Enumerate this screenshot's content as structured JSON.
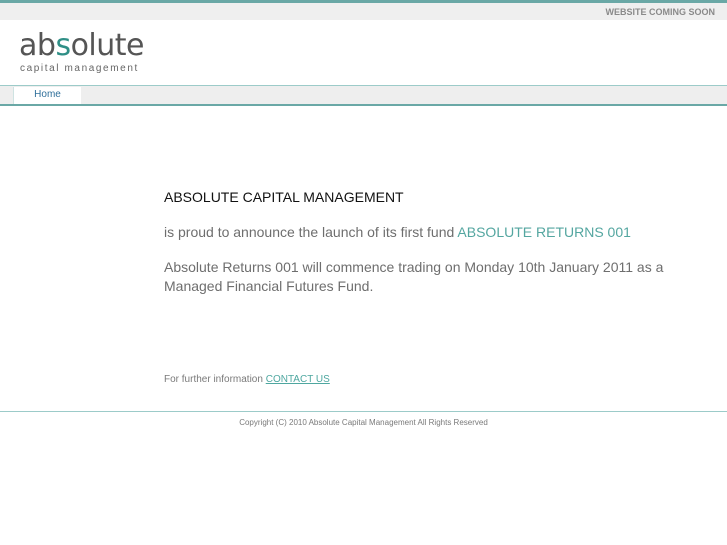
{
  "header": {
    "coming_soon": "WEBSITE COMING SOON"
  },
  "logo": {
    "word_start": "ab",
    "word_accent": "s",
    "word_end": "olute",
    "tagline": "capital management"
  },
  "nav": {
    "home_label": "Home"
  },
  "main": {
    "headline": "ABSOLUTE CAPITAL MANAGEMENT",
    "announce_text": "is proud to announce the launch of its first fund ",
    "fund_name": "ABSOLUTE RETURNS 001",
    "trading_text": "Absolute Returns 001 will commence trading on Monday 10th January 2011 as a Managed Financial Futures Fund."
  },
  "contact": {
    "prefix": "For further information ",
    "link_label": "CONTACT US"
  },
  "footer": {
    "copyright": "Copyright (C) 2010 Absolute Capital Management All Rights Reserved"
  },
  "colors": {
    "accent": "#6aa8a6",
    "link": "#4ea7a0",
    "nav_link": "#2f6f9a"
  }
}
